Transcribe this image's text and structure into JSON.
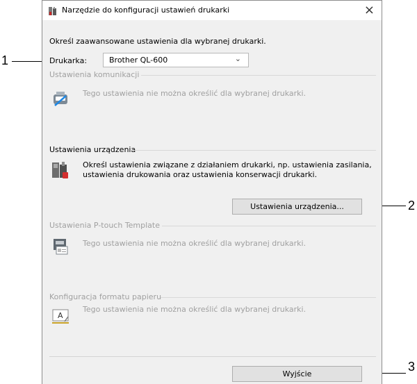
{
  "callouts": [
    "1",
    "2",
    "3"
  ],
  "window": {
    "title": "Narzędzie do konfiguracji ustawień drukarki",
    "close_symbol": "×"
  },
  "intro_text": "Określ zaawansowane ustawienia dla wybranej drukarki.",
  "printer": {
    "label": "Drukarka:",
    "selected": "Brother QL-600"
  },
  "sections": {
    "communication": {
      "title": "Ustawienia komunikacji",
      "text": "Tego ustawienia nie można określić dla wybranej drukarki.",
      "icon": "communication-icon",
      "enabled": false
    },
    "device": {
      "title": "Ustawienia urządzenia",
      "text_line1": "Określ ustawienia związane z działaniem drukarki, np. ustawienia zasilania,",
      "text_line2": "ustawienia drukowania oraz ustawienia konserwacji drukarki.",
      "button": "Ustawienia urządzenia...",
      "icon": "device-settings-icon",
      "enabled": true
    },
    "ptouch": {
      "title": "Ustawienia P-touch Template",
      "text": "Tego ustawienia nie można określić dla wybranej drukarki.",
      "icon": "ptouch-template-icon",
      "enabled": false
    },
    "paper": {
      "title": "Konfiguracja formatu papieru",
      "text": "Tego ustawienia nie można określić dla wybranej drukarki.",
      "icon": "paper-format-icon",
      "enabled": false
    }
  },
  "exit_button": "Wyjście",
  "colors": {
    "window_bg": "#f0f0f0",
    "disabled_text": "#a0a0a0",
    "button_bg": "#e1e1e1"
  }
}
